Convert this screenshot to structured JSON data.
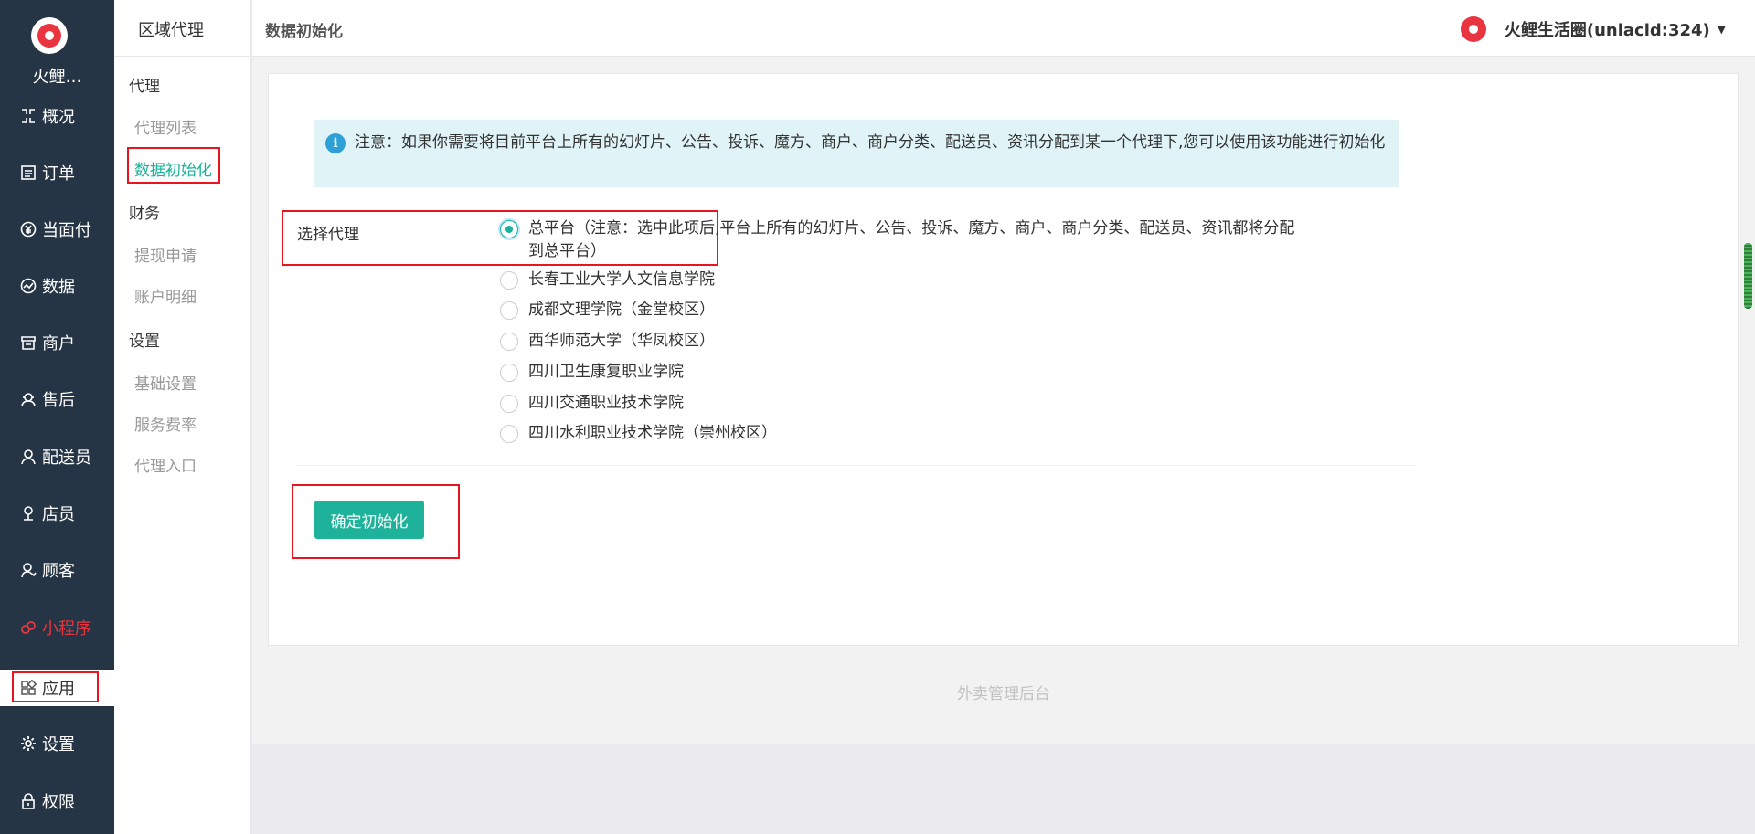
{
  "brand": {
    "name": "火鲤…",
    "accent": "#e8353f"
  },
  "nav": [
    {
      "label": "概况",
      "icon": "overview-icon"
    },
    {
      "label": "订单",
      "icon": "order-icon"
    },
    {
      "label": "当面付",
      "icon": "yen-icon"
    },
    {
      "label": "数据",
      "icon": "chart-icon"
    },
    {
      "label": "商户",
      "icon": "store-icon"
    },
    {
      "label": "售后",
      "icon": "support-icon"
    },
    {
      "label": "配送员",
      "icon": "user-icon"
    },
    {
      "label": "店员",
      "icon": "clerk-icon"
    },
    {
      "label": "顾客",
      "icon": "customer-icon"
    },
    {
      "label": "小程序",
      "icon": "miniprogram-icon"
    },
    {
      "label": "应用",
      "icon": "apps-icon"
    },
    {
      "label": "设置",
      "icon": "gear-icon"
    },
    {
      "label": "权限",
      "icon": "lock-icon"
    }
  ],
  "sub_nav": {
    "title": "区域代理",
    "groups": [
      {
        "label": "代理",
        "items": [
          "代理列表",
          "数据初始化"
        ]
      },
      {
        "label": "财务",
        "items": [
          "提现申请",
          "账户明细"
        ]
      },
      {
        "label": "设置",
        "items": [
          "基础设置",
          "服务费率",
          "代理入口"
        ]
      }
    ],
    "active": "数据初始化"
  },
  "header": {
    "title": "数据初始化",
    "user": "火鲤生活圈(uniacid:324)"
  },
  "notice": "注意：如果你需要将目前平台上所有的幻灯片、公告、投诉、魔方、商户、商户分类、配送员、资讯分配到某一个代理下,您可以使用该功能进行初始化",
  "form": {
    "label": "选择代理",
    "options": [
      {
        "text": "总平台（注意：选中此项后,平台上所有的幻灯片、公告、投诉、魔方、商户、商户分类、配送员、资讯都将分配到总平台）",
        "checked": true
      },
      {
        "text": "长春工业大学人文信息学院",
        "checked": false
      },
      {
        "text": "成都文理学院（金堂校区）",
        "checked": false
      },
      {
        "text": "西华师范大学（华凤校区）",
        "checked": false
      },
      {
        "text": "四川卫生康复职业学院",
        "checked": false
      },
      {
        "text": "四川交通职业技术学院",
        "checked": false
      },
      {
        "text": "四川水利职业技术学院（崇州校区）",
        "checked": false
      }
    ],
    "submit": "确定初始化"
  },
  "footer": "外卖管理后台",
  "colors": {
    "sidebar": "#263545",
    "primary": "#1fb29a",
    "highlight": "#e8141e"
  }
}
